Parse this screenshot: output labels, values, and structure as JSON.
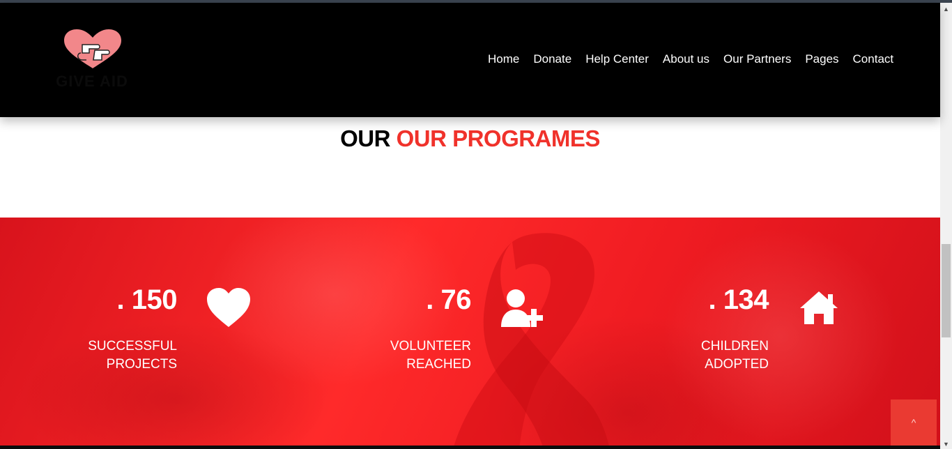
{
  "brand": {
    "logo_text": "GIVE AID"
  },
  "nav": {
    "items": [
      "Home",
      "Donate",
      "Help Center",
      "About us",
      "Our Partners",
      "Pages",
      "Contact"
    ]
  },
  "programs": {
    "title_part1": "OUR",
    "title_part2": "OUR PROGRAMES"
  },
  "stats": [
    {
      "value": ". 150",
      "label_line1": "SUCCESSFUL",
      "label_line2": "PROJECTS",
      "icon": "heart-icon"
    },
    {
      "value": ". 76",
      "label_line1": "VOLUNTEER",
      "label_line2": "REACHED",
      "icon": "user-plus-icon"
    },
    {
      "value": ". 134",
      "label_line1": "CHILDREN",
      "label_line2": "ADOPTED",
      "icon": "home-icon"
    }
  ],
  "back_to_top": {
    "icon": "chevron-up-icon",
    "glyph": "^"
  },
  "colors": {
    "navbar_bg": "#000000",
    "accent": "#f0322b",
    "stats_bg": "#f01c22",
    "back_to_top_bg": "#ea3a32"
  }
}
